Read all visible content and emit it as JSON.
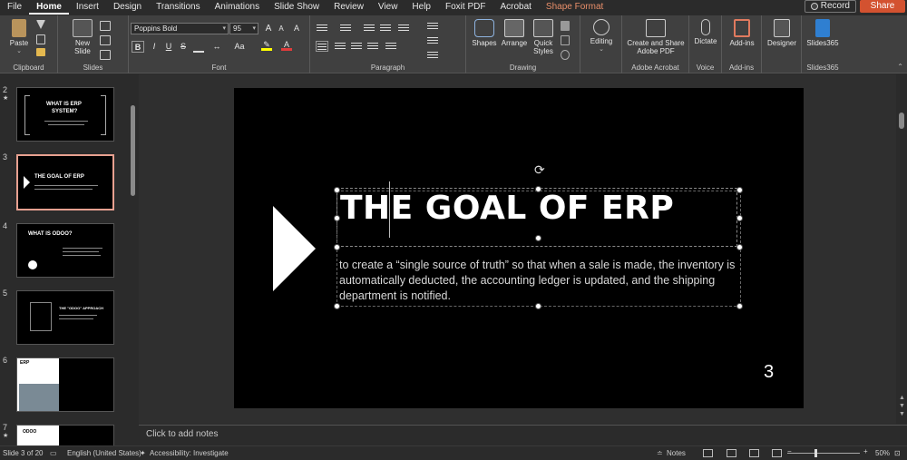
{
  "menu": {
    "tabs": [
      "File",
      "Home",
      "Insert",
      "Design",
      "Transitions",
      "Animations",
      "Slide Show",
      "Review",
      "View",
      "Help",
      "Foxit PDF",
      "Acrobat",
      "Shape Format"
    ],
    "active": "Home",
    "record_label": "Record",
    "share_label": "Share"
  },
  "ribbon": {
    "clipboard": {
      "label": "Clipboard",
      "paste": "Paste"
    },
    "slides": {
      "label": "Slides",
      "new_slide_line1": "New",
      "new_slide_line2": "Slide"
    },
    "font": {
      "label": "Font",
      "font_name": "Poppins Bold",
      "font_size": "95",
      "bold": "B",
      "italic": "I",
      "underline": "U",
      "strike": "S",
      "grow": "A",
      "shrink": "A",
      "aa": "Aa",
      "clear": "A"
    },
    "paragraph": {
      "label": "Paragraph"
    },
    "drawing": {
      "label": "Drawing",
      "shapes": "Shapes",
      "arrange": "Arrange",
      "quick_styles_line1": "Quick",
      "quick_styles_line2": "Styles"
    },
    "editing": {
      "label": "Editing"
    },
    "adobe": {
      "label": "Adobe Acrobat",
      "line1": "Create and Share",
      "line2": "Adobe PDF"
    },
    "voice": {
      "label": "Voice",
      "dictate": "Dictate"
    },
    "addins": {
      "label": "Add-ins",
      "addins": "Add-ins"
    },
    "designer": {
      "designer": "Designer"
    },
    "slides365": {
      "label": "Slides365",
      "slides365": "Slides365"
    }
  },
  "thumbnails": [
    {
      "num": "2",
      "star": "★",
      "title_line1": "WHAT IS ERP",
      "title_line2": "SYSTEM?"
    },
    {
      "num": "3",
      "star": "",
      "title": "THE GOAL OF ERP"
    },
    {
      "num": "4",
      "star": "",
      "title": "WHAT IS ODOO?"
    },
    {
      "num": "5",
      "star": "",
      "title": "THE \"ODOO\" APPROACH"
    },
    {
      "num": "6",
      "star": "",
      "title": "ERP"
    },
    {
      "num": "7",
      "star": "★",
      "title": "ODOO"
    }
  ],
  "slide": {
    "title": "THE GOAL OF ERP",
    "body": "to create a “single source of truth” so that when a sale is made, the inventory is automatically deducted, the accounting ledger is updated, and the shipping department is notified.",
    "number": "3"
  },
  "notes": {
    "placeholder": "Click to add notes"
  },
  "status": {
    "slide_info": "Slide 3 of 20",
    "language": "English (United States)",
    "accessibility": "Accessibility: Investigate",
    "notes_btn": "Notes",
    "zoom": "50%"
  }
}
